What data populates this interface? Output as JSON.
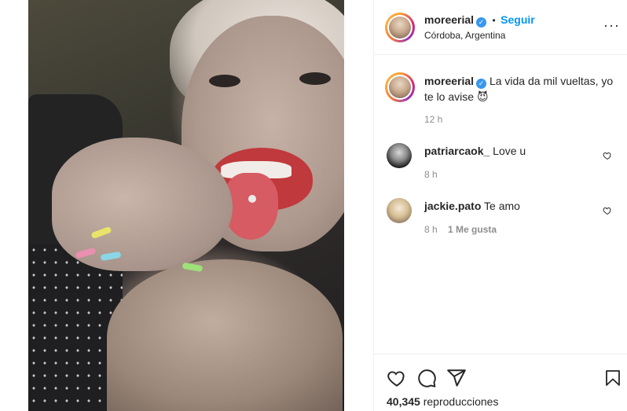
{
  "post": {
    "username": "moreerial",
    "follow_label": "Seguir",
    "location": "Córdoba, Argentina",
    "caption": "La vida da mil vueltas, yo te lo avise",
    "caption_emoji": "😈",
    "caption_time": "12 h",
    "views_count": "40,345",
    "views_label": "reproducciones"
  },
  "comments": [
    {
      "username": "patriarcaok_",
      "text": "Love u",
      "time": "8 h",
      "likes": ""
    },
    {
      "username": "jackie.pato",
      "text": "Te amo",
      "time": "8 h",
      "likes": "1 Me gusta"
    }
  ],
  "separator_dot": "•",
  "icons": {
    "more": "more-options-icon",
    "verified": "verified-badge-icon",
    "like": "heart-icon",
    "comment": "comment-icon",
    "share": "share-icon",
    "save": "bookmark-icon"
  },
  "colors": {
    "follow_blue": "#0095f6",
    "verified_blue": "#3897f0",
    "meta_gray": "#8e8e8e"
  }
}
